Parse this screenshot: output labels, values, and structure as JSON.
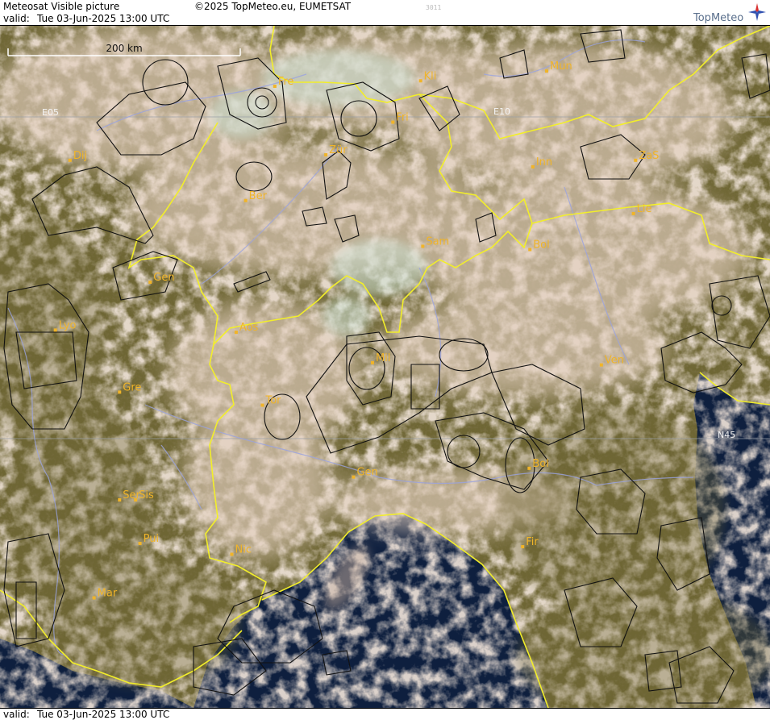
{
  "header": {
    "title": "Meteosat Visible picture",
    "valid_label": "valid:",
    "valid_time": "Tue  03-Jun-2025  13:00 UTC",
    "copyright": "©2025 TopMeteo.eu, EUMETSAT",
    "code": "3011",
    "logo_text": "TopMeteo"
  },
  "footer": {
    "valid_label": "valid:",
    "valid_time": "Tue  03-Jun-2025  13:00 UTC"
  },
  "map": {
    "scale_label": "200 km",
    "grid_labels": {
      "e05": "E05",
      "e10": "E10",
      "n45": "N45"
    },
    "cities": [
      {
        "name": "Fre",
        "lon": 7.85,
        "lat": 48.0
      },
      {
        "name": "Kli",
        "lon": 9.85,
        "lat": 48.05
      },
      {
        "name": "Mun",
        "lon": 11.58,
        "lat": 48.14
      },
      {
        "name": "Dij",
        "lon": 5.04,
        "lat": 47.32
      },
      {
        "name": "Fri",
        "lon": 9.47,
        "lat": 47.67
      },
      {
        "name": "Zür",
        "lon": 8.55,
        "lat": 47.37
      },
      {
        "name": "Inn",
        "lon": 11.39,
        "lat": 47.26
      },
      {
        "name": "ZaS",
        "lon": 12.8,
        "lat": 47.32
      },
      {
        "name": "Ber",
        "lon": 7.45,
        "lat": 46.95
      },
      {
        "name": "Lie",
        "lon": 12.77,
        "lat": 46.83
      },
      {
        "name": "Sam",
        "lon": 9.88,
        "lat": 46.53
      },
      {
        "name": "Bol",
        "lon": 11.35,
        "lat": 46.5
      },
      {
        "name": "Gen",
        "lon": 6.14,
        "lat": 46.2
      },
      {
        "name": "Lyo",
        "lon": 4.84,
        "lat": 45.76
      },
      {
        "name": "Aos",
        "lon": 7.32,
        "lat": 45.74
      },
      {
        "name": "Mil",
        "lon": 9.19,
        "lat": 45.46
      },
      {
        "name": "Ven",
        "lon": 12.33,
        "lat": 45.44
      },
      {
        "name": "Gre",
        "lon": 5.72,
        "lat": 45.19
      },
      {
        "name": "Tor",
        "lon": 7.68,
        "lat": 45.07
      },
      {
        "name": "Ser",
        "lon": 5.72,
        "lat": 44.2
      },
      {
        "name": "Gen",
        "lon": 8.93,
        "lat": 44.41
      },
      {
        "name": "Bol",
        "lon": 11.34,
        "lat": 44.49
      },
      {
        "name": "Sis",
        "lon": 5.94,
        "lat": 44.2
      },
      {
        "name": "Pui",
        "lon": 6.0,
        "lat": 43.8
      },
      {
        "name": "Nic",
        "lon": 7.26,
        "lat": 43.7
      },
      {
        "name": "Fir",
        "lon": 11.25,
        "lat": 43.77
      },
      {
        "name": "Mar",
        "lon": 5.37,
        "lat": 43.3
      }
    ]
  },
  "colors": {
    "land": "#6e6634",
    "sea": "#0e1f3e",
    "cloud": "#d9c0ab",
    "border": "#f2ee2a",
    "airspace": "#111111",
    "river": "#9aa3e0",
    "label": "#f0b429",
    "grid": "#9aa0a8"
  }
}
